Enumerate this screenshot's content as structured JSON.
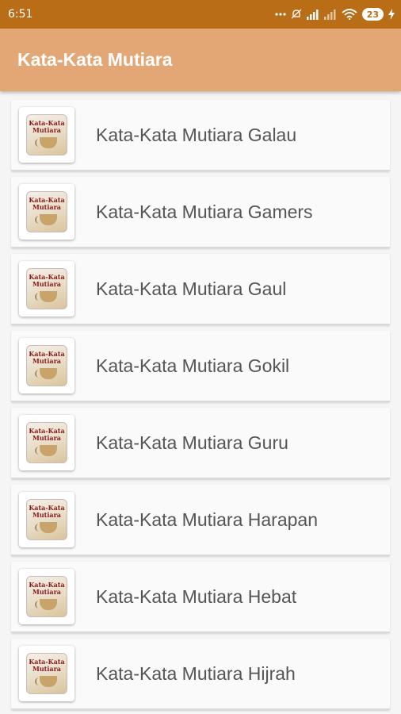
{
  "status_bar": {
    "time": "6:51",
    "icons": [
      "more-icon",
      "mute-icon",
      "signal-icon",
      "signal-icon",
      "wifi-icon",
      "battery-icon",
      "charging-icon"
    ],
    "battery": "23"
  },
  "app_bar": {
    "title": "Kata-Kata Mutiara"
  },
  "items": [
    {
      "label": "Kata-Kata Mutiara Galau",
      "thumb_line1": "Kata-Kata",
      "thumb_line2": "Mutiara"
    },
    {
      "label": "Kata-Kata Mutiara Gamers",
      "thumb_line1": "Kata-Kata",
      "thumb_line2": "Mutiara"
    },
    {
      "label": "Kata-Kata Mutiara Gaul",
      "thumb_line1": "Kata-Kata",
      "thumb_line2": "Mutiara"
    },
    {
      "label": "Kata-Kata Mutiara Gokil",
      "thumb_line1": "Kata-Kata",
      "thumb_line2": "Mutiara"
    },
    {
      "label": "Kata-Kata Mutiara Guru",
      "thumb_line1": "Kata-Kata",
      "thumb_line2": "Mutiara"
    },
    {
      "label": "Kata-Kata Mutiara Harapan",
      "thumb_line1": "Kata-Kata",
      "thumb_line2": "Mutiara"
    },
    {
      "label": "Kata-Kata Mutiara Hebat",
      "thumb_line1": "Kata-Kata",
      "thumb_line2": "Mutiara"
    },
    {
      "label": "Kata-Kata Mutiara Hijrah",
      "thumb_line1": "Kata-Kata",
      "thumb_line2": "Mutiara"
    }
  ]
}
